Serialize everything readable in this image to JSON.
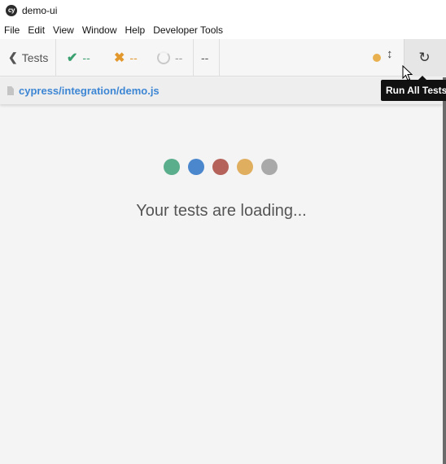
{
  "window": {
    "title": "demo-ui",
    "logo_text": "cy"
  },
  "menu": {
    "items": [
      "File",
      "Edit",
      "View",
      "Window",
      "Help",
      "Developer Tools"
    ]
  },
  "toolbar": {
    "tests_label": "Tests",
    "passed": "--",
    "failed": "--",
    "pending": "--",
    "duration": "--",
    "status_dot_color": "#e8b04f",
    "reload_tooltip": "Run All Tests"
  },
  "spec": {
    "path": "cypress/integration/demo.js"
  },
  "loader": {
    "dot_colors": [
      "#5bae8c",
      "#4b87cd",
      "#b5635a",
      "#e0ae5f",
      "#a9a9a9"
    ],
    "message": "Your tests are loading..."
  }
}
